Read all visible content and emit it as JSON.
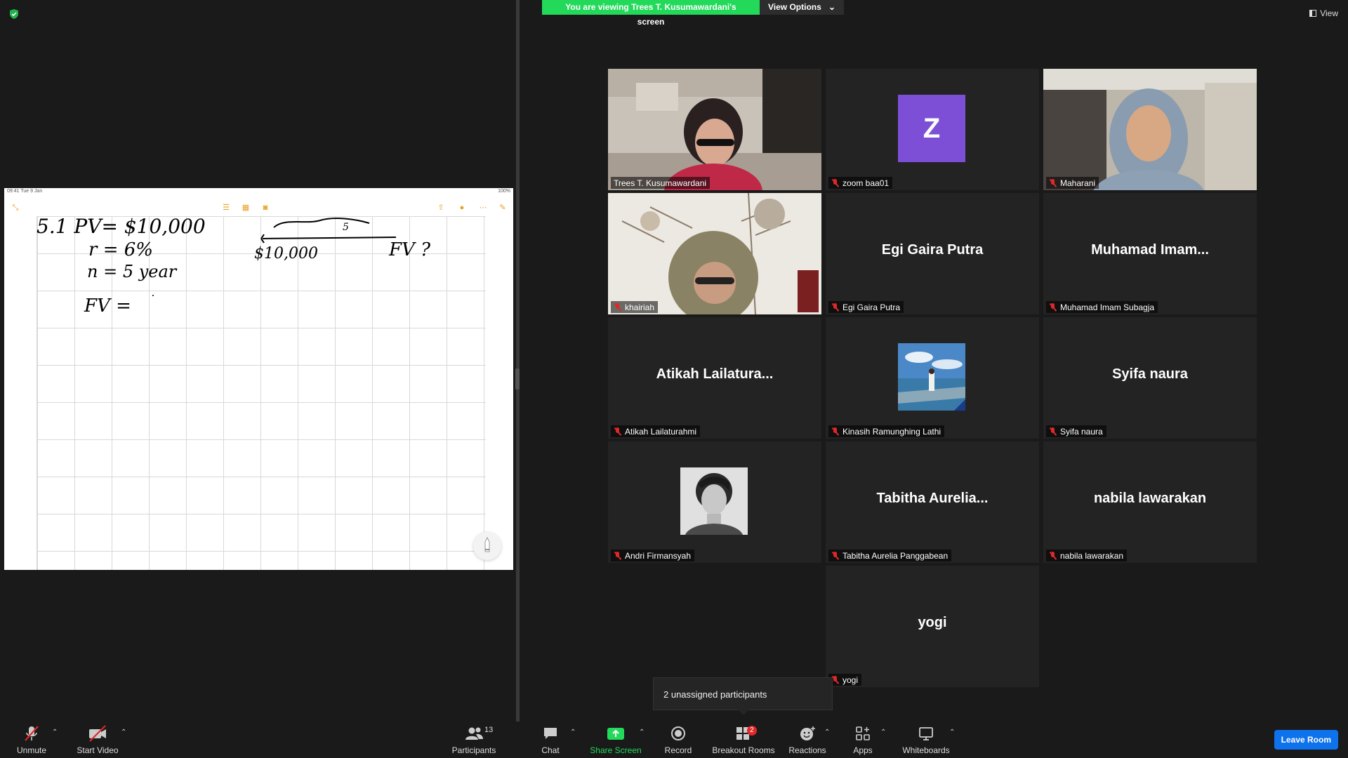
{
  "banner": {
    "message": "You are viewing Trees T. Kusumawardani's screen",
    "view_options": "View Options",
    "view": "View"
  },
  "shared_screen": {
    "status_time": "09:41  Tue 9 Jan",
    "status_right": "100%",
    "handwriting": {
      "line1": "5.1   PV= $10,000",
      "line2": "r = 6%",
      "line3": "n = 5 year",
      "line4": "FV =",
      "timeline_label": "5",
      "timeline_start": "$10,000",
      "timeline_end": "FV ?"
    }
  },
  "participants": [
    {
      "display": "video",
      "name": "Trees T. Kusumawardani",
      "muted": false,
      "active": true
    },
    {
      "display": "avatar",
      "initial": "Z",
      "name": "zoom baa01",
      "muted": true
    },
    {
      "display": "video",
      "name": "Maharani",
      "muted": true
    },
    {
      "display": "video",
      "name": "khairiah",
      "muted": true
    },
    {
      "display": "name",
      "big_name": "Egi Gaira Putra",
      "name": "Egi Gaira Putra",
      "muted": true
    },
    {
      "display": "name",
      "big_name": "Muhamad  Imam...",
      "name": "Muhamad Imam Subagja",
      "muted": true
    },
    {
      "display": "name",
      "big_name": "Atikah  Lailatura...",
      "name": "Atikah Lailaturahmi",
      "muted": true
    },
    {
      "display": "photo",
      "name": "Kinasih Ramunghing Lathi",
      "muted": true
    },
    {
      "display": "name",
      "big_name": "Syifa naura",
      "name": "Syifa naura",
      "muted": true
    },
    {
      "display": "photo",
      "name": "Andri Firmansyah",
      "muted": true
    },
    {
      "display": "name",
      "big_name": "Tabitha  Aurelia...",
      "name": "Tabitha Aurelia Panggabean",
      "muted": true
    },
    {
      "display": "name",
      "big_name": "nabila lawarakan",
      "name": "nabila lawarakan",
      "muted": true
    },
    {
      "display": "name",
      "big_name": "yogi",
      "name": "yogi",
      "muted": true
    }
  ],
  "tooltip": "2 unassigned participants",
  "toolbar": {
    "unmute": "Unmute",
    "start_video": "Start Video",
    "participants": "Participants",
    "participants_count": "13",
    "chat": "Chat",
    "share_screen": "Share Screen",
    "record": "Record",
    "breakout_rooms": "Breakout Rooms",
    "breakout_badge": "2",
    "reactions": "Reactions",
    "apps": "Apps",
    "whiteboards": "Whiteboards",
    "leave_room": "Leave Room"
  },
  "colors": {
    "banner_green": "#23d959",
    "active_speaker": "#d7ee5f",
    "mute_red": "#e02828",
    "leave_blue": "#0e72ed",
    "avatar_purple": "#7d4fd6"
  }
}
